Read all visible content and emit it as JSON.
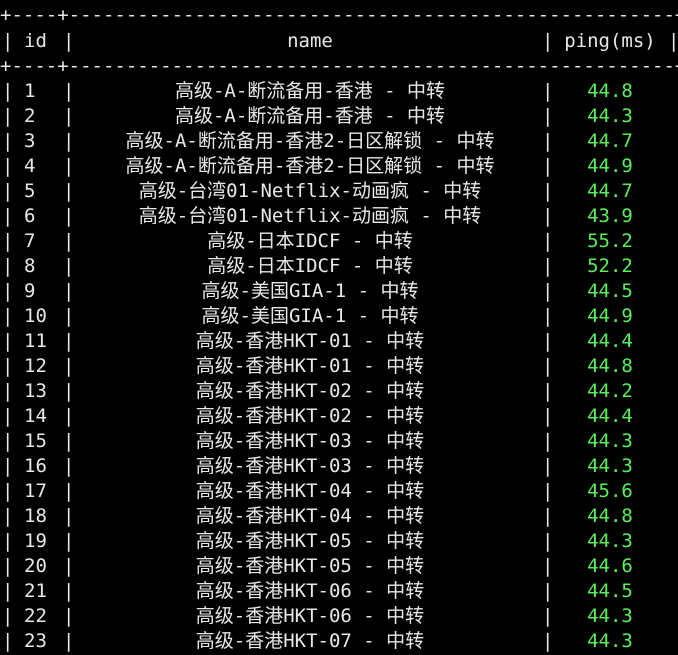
{
  "prompt_fragment": "",
  "border_line": "+----+-----------------------------------------------------+----------+",
  "columns": {
    "id": "id",
    "name": "name",
    "ping": "ping(ms)"
  },
  "colors": {
    "background": "#000000",
    "text": "#e8e8e8",
    "ping_value": "#5af05a"
  },
  "rows": [
    {
      "id": "1",
      "name": "高级-A-断流备用-香港 - 中转",
      "ping": "44.8"
    },
    {
      "id": "2",
      "name": "高级-A-断流备用-香港 - 中转",
      "ping": "44.3"
    },
    {
      "id": "3",
      "name": "高级-A-断流备用-香港2-日区解锁 - 中转",
      "ping": "44.7"
    },
    {
      "id": "4",
      "name": "高级-A-断流备用-香港2-日区解锁 - 中转",
      "ping": "44.9"
    },
    {
      "id": "5",
      "name": "高级-台湾01-Netflix-动画疯 - 中转",
      "ping": "44.7"
    },
    {
      "id": "6",
      "name": "高级-台湾01-Netflix-动画疯 - 中转",
      "ping": "43.9"
    },
    {
      "id": "7",
      "name": "高级-日本IDCF - 中转",
      "ping": "55.2"
    },
    {
      "id": "8",
      "name": "高级-日本IDCF - 中转",
      "ping": "52.2"
    },
    {
      "id": "9",
      "name": "高级-美国GIA-1 - 中转",
      "ping": "44.5"
    },
    {
      "id": "10",
      "name": "高级-美国GIA-1 - 中转",
      "ping": "44.9"
    },
    {
      "id": "11",
      "name": "高级-香港HKT-01 - 中转",
      "ping": "44.4"
    },
    {
      "id": "12",
      "name": "高级-香港HKT-01 - 中转",
      "ping": "44.8"
    },
    {
      "id": "13",
      "name": "高级-香港HKT-02 - 中转",
      "ping": "44.2"
    },
    {
      "id": "14",
      "name": "高级-香港HKT-02 - 中转",
      "ping": "44.4"
    },
    {
      "id": "15",
      "name": "高级-香港HKT-03 - 中转",
      "ping": "44.3"
    },
    {
      "id": "16",
      "name": "高级-香港HKT-03 - 中转",
      "ping": "44.3"
    },
    {
      "id": "17",
      "name": "高级-香港HKT-04 - 中转",
      "ping": "45.6"
    },
    {
      "id": "18",
      "name": "高级-香港HKT-04 - 中转",
      "ping": "44.8"
    },
    {
      "id": "19",
      "name": "高级-香港HKT-05 - 中转",
      "ping": "44.3"
    },
    {
      "id": "20",
      "name": "高级-香港HKT-05 - 中转",
      "ping": "44.6"
    },
    {
      "id": "21",
      "name": "高级-香港HKT-06 - 中转",
      "ping": "44.5"
    },
    {
      "id": "22",
      "name": "高级-香港HKT-06 - 中转",
      "ping": "44.3"
    },
    {
      "id": "23",
      "name": "高级-香港HKT-07 - 中转",
      "ping": "44.3"
    }
  ]
}
